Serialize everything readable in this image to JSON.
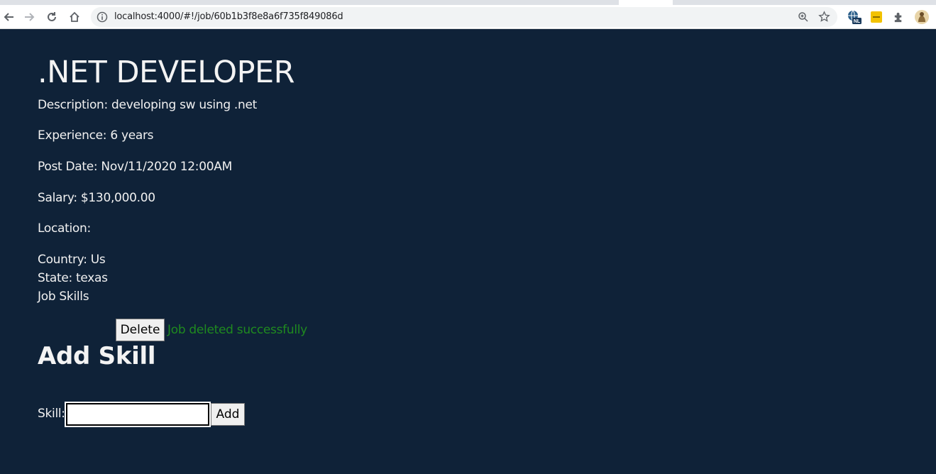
{
  "browser": {
    "url": "localhost:4000/#!/job/60b1b3f8e8a6f735f849086d",
    "extensions": [
      "translate-extension-icon",
      "yellow-extension-icon",
      "puzzle-extension-icon",
      "profile-avatar-icon"
    ],
    "extension_badge": "NL"
  },
  "job": {
    "title": ".NET DEVELOPER",
    "description": "Description: developing sw using .net",
    "experience": "Experience: 6 years",
    "post_date": "Post Date: Nov/11/2020 12:00AM",
    "salary": "Salary: $130,000.00",
    "location_label": "Location:",
    "country": "Country: Us",
    "state": "State: texas",
    "skills_label": "Job Skills"
  },
  "actions": {
    "delete_label": "Delete",
    "status_message": "Job deleted successfully",
    "status_color": "#1f8a1f"
  },
  "add_skill": {
    "heading": "Add Skill",
    "skill_label": "Skill:",
    "skill_value": "",
    "add_label": "Add"
  }
}
